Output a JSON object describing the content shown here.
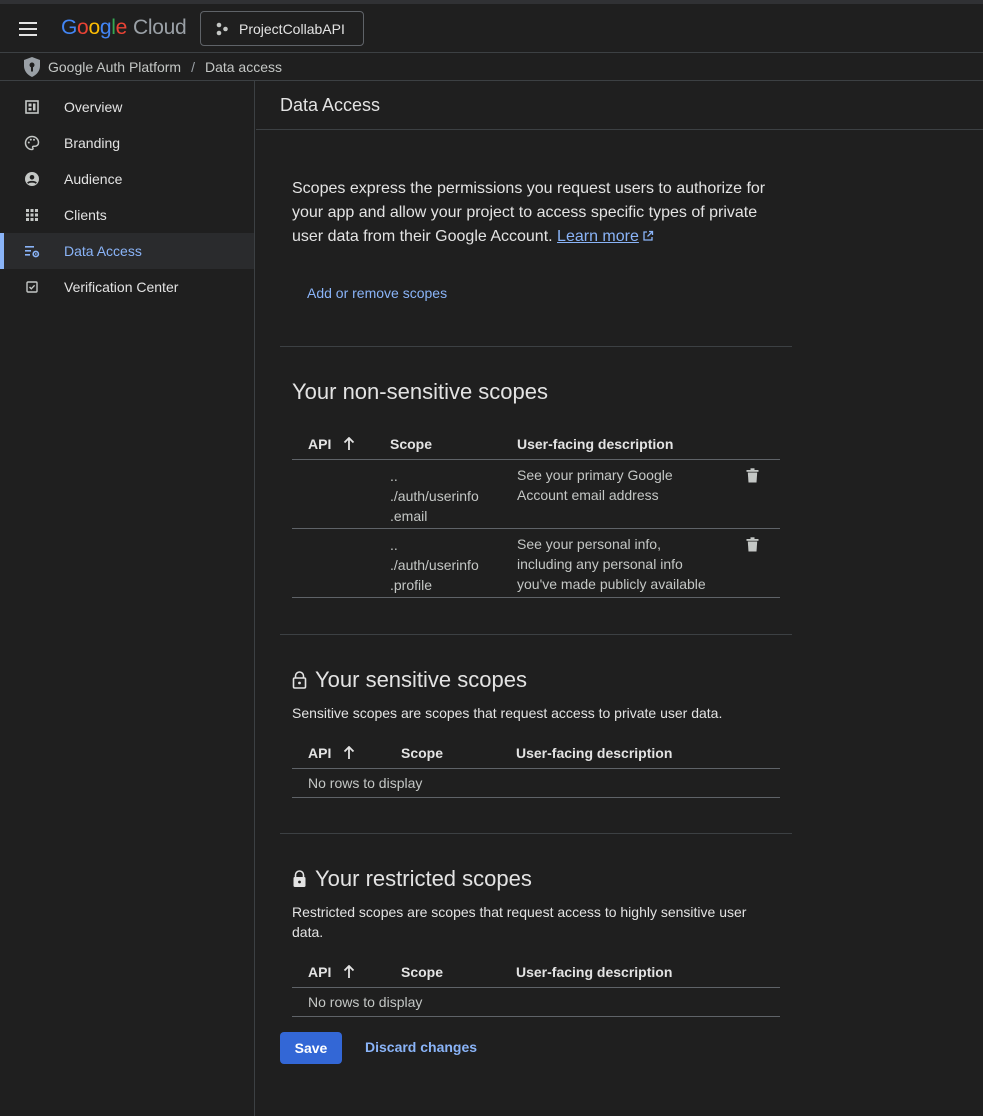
{
  "header": {
    "logo_google": [
      "G",
      "o",
      "o",
      "g",
      "l",
      "e"
    ],
    "logo_cloud": "Cloud",
    "project_name": "ProjectCollabAPI"
  },
  "breadcrumb": {
    "root": "Google Auth Platform",
    "separator": "/",
    "current": "Data access"
  },
  "sidebar": {
    "items": [
      {
        "label": "Overview",
        "icon": "dashboard-icon",
        "active": false
      },
      {
        "label": "Branding",
        "icon": "palette-icon",
        "active": false
      },
      {
        "label": "Audience",
        "icon": "person-icon",
        "active": false
      },
      {
        "label": "Clients",
        "icon": "grid-icon",
        "active": false
      },
      {
        "label": "Data Access",
        "icon": "data-settings-icon",
        "active": true
      },
      {
        "label": "Verification Center",
        "icon": "checkbox-icon",
        "active": false
      }
    ]
  },
  "main": {
    "title": "Data Access",
    "intro_text": "Scopes express the permissions you request users to authorize for your app and allow your project to access specific types of private user data from their Google Account.",
    "learn_more": "Learn more",
    "add_remove_scopes": "Add or remove scopes",
    "table_headers": {
      "api": "API",
      "scope": "Scope",
      "description": "User-facing description"
    },
    "non_sensitive": {
      "title": "Your non-sensitive scopes",
      "rows": [
        {
          "scope_lines": [
            "..",
            "./auth/userinfo",
            ".email"
          ],
          "description_lines": [
            "See your primary Google",
            "Account email address"
          ]
        },
        {
          "scope_lines": [
            "..",
            "./auth/userinfo",
            ".profile"
          ],
          "description_lines": [
            "See your personal info,",
            "including any personal info",
            "you've made publicly available"
          ]
        }
      ]
    },
    "sensitive": {
      "title": "Your sensitive scopes",
      "description": "Sensitive scopes are scopes that request access to private user data.",
      "empty_text": "No rows to display"
    },
    "restricted": {
      "title": "Your restricted scopes",
      "description": "Restricted scopes are scopes that request access to highly sensitive user data.",
      "empty_text": "No rows to display"
    },
    "save_label": "Save",
    "discard_label": "Discard changes"
  },
  "colors": {
    "background": "#1f1f1f",
    "accent": "#8ab4f8",
    "primary_button": "#3367d6"
  }
}
